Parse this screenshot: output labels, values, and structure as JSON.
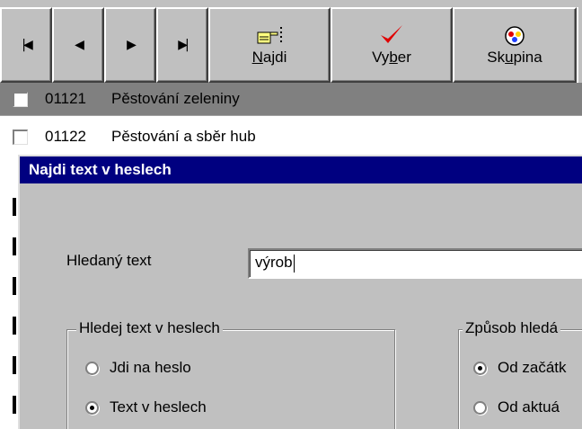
{
  "toolbar": {
    "nav": [
      {
        "name": "first-record-button",
        "glyph": "|◀"
      },
      {
        "name": "previous-record-button",
        "glyph": "◀"
      },
      {
        "name": "next-record-button",
        "glyph": "▶"
      },
      {
        "name": "last-record-button",
        "glyph": "▶|"
      }
    ],
    "najdi": {
      "pre": "",
      "u": "N",
      "post": "ajdi",
      "icon": "pointing-hand-icon"
    },
    "vyber": {
      "pre": "Vy",
      "u": "b",
      "post": "er",
      "icon": "checkmark-icon"
    },
    "skupina": {
      "pre": "Sk",
      "u": "u",
      "post": "pina",
      "icon": "group-icon"
    }
  },
  "rows": [
    {
      "code": "01121",
      "name": "Pěstování zeleniny",
      "selected": true
    },
    {
      "code": "01122",
      "name": "Pěstování a sběr hub",
      "selected": false
    }
  ],
  "dialog": {
    "title": "Najdi text v heslech",
    "search_label": "Hledaný text",
    "search_value": "výrob",
    "group1": {
      "legend": "Hledej text v heslech",
      "options": [
        {
          "label": "Jdi na heslo",
          "checked": false
        },
        {
          "label": "Text v heslech",
          "checked": true
        }
      ]
    },
    "group2": {
      "legend": "Způsob hledá",
      "options": [
        {
          "label": "Od začátk",
          "checked": true
        },
        {
          "label": "Od aktuá",
          "checked": false
        }
      ]
    }
  },
  "colors": {
    "titlebar": "#000080",
    "face": "#c0c0c0",
    "selected_row": "#808080",
    "check_red": "#e00000"
  }
}
